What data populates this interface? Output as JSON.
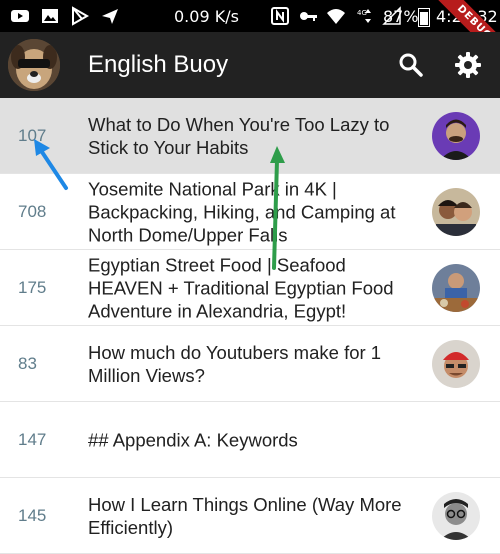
{
  "status_bar": {
    "icons": [
      "youtube-icon",
      "image-icon",
      "play-store-icon",
      "send-icon",
      "nfc-icon",
      "vpn-key-icon",
      "wifi-icon",
      "lte-icon",
      "signal-icon"
    ],
    "network_speed": "0.09 K/s",
    "battery_percent": "87%",
    "time": "4:22:32"
  },
  "debug_banner": "DEBUG",
  "app_bar": {
    "title": "English Buoy",
    "actions": [
      "search-icon",
      "settings-gear-icon"
    ]
  },
  "articles": [
    {
      "count": "107",
      "title": "What to Do When You're Too Lazy to Stick to Your Habits",
      "thumb": "avatar-man-purple-background",
      "selected": true
    },
    {
      "count": "708",
      "title": "Yosemite National Park in 4K | Backpacking, Hiking, and Camping at North Dome/Upper Falls",
      "thumb": "avatar-group-outdoors",
      "selected": false
    },
    {
      "count": "175",
      "title": "Egyptian Street Food | Seafood HEAVEN + Traditional Egyptian Food Adventure in Alexandria, Egypt!",
      "thumb": "avatar-food-market",
      "selected": false
    },
    {
      "count": "83",
      "title": "How much do Youtubers make for 1 Million Views?",
      "thumb": "avatar-man-red-cap",
      "selected": false
    },
    {
      "count": "147",
      "title": "## Appendix A: Keywords",
      "thumb": "",
      "selected": false
    },
    {
      "count": "145",
      "title": "How I Learn Things Online (Way More Efficiently)",
      "thumb": "avatar-man-glasses-grayscale",
      "selected": false
    }
  ],
  "annotations": {
    "blue_arrow_color": "#1e88e5",
    "green_arrow_color": "#2e9d4a"
  },
  "colors": {
    "app_bar": "#222222",
    "selected_row": "#e0e0e0",
    "count_text": "#607d8b"
  }
}
